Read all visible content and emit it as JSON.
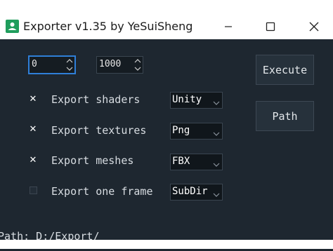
{
  "window": {
    "title": "Exporter v1.35 by YeSuiSheng",
    "controls": {
      "minimize": "minimize-icon",
      "maximize": "maximize-icon",
      "close": "close-icon"
    }
  },
  "range": {
    "start_value": "0",
    "end_value": "1000"
  },
  "options": [
    {
      "label": "Export shaders",
      "checked": true,
      "select_value": "Unity"
    },
    {
      "label": "Export textures",
      "checked": true,
      "select_value": "Png"
    },
    {
      "label": "Export meshes",
      "checked": true,
      "select_value": "FBX"
    },
    {
      "label": "Export one frame",
      "checked": false,
      "select_value": "SubDir"
    }
  ],
  "buttons": {
    "execute_label": "Execute",
    "path_label": "Path"
  },
  "status": {
    "path_text": "Path: D:/Export/"
  },
  "colors": {
    "client_bg": "#1e2730",
    "accent_focus": "#2f7fd8",
    "app_icon": "#1f9d5c"
  }
}
